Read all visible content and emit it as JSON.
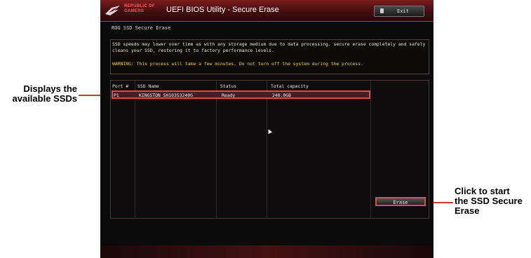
{
  "annotations": {
    "left": [
      "Displays the",
      "available SSDs"
    ],
    "right": [
      "Click to start",
      "the SSD Secure",
      "Erase"
    ],
    "line_color": "#d0392b"
  },
  "header": {
    "brand_line1": "REPUBLIC OF",
    "brand_line2": "GAMERS",
    "title": "UEFI BIOS Utility - Secure Erase",
    "exit_label": "Exit",
    "exit_icon": "power-icon"
  },
  "section_title": "ROG SSD Secure Erase",
  "info": {
    "description": "SSD speeds may lower over time as with any storage medium due to data processing. secure erase completely and safely cleans your SSD, restoring it to factory performance levels.",
    "warning": "WARNING: This process will take a few minutes. Do not turn off the system during the process."
  },
  "table": {
    "columns": [
      "Port #",
      "SSD Name",
      "Status",
      "Total capacity"
    ],
    "rows": [
      [
        "P1",
        "KINGSTON SH103S3240G",
        "Ready",
        "240.0GB"
      ]
    ]
  },
  "erase_label": "Erase",
  "colors": {
    "accent": "#e04a42",
    "warning": "#f1d21a",
    "background": "#0b0b0c"
  }
}
